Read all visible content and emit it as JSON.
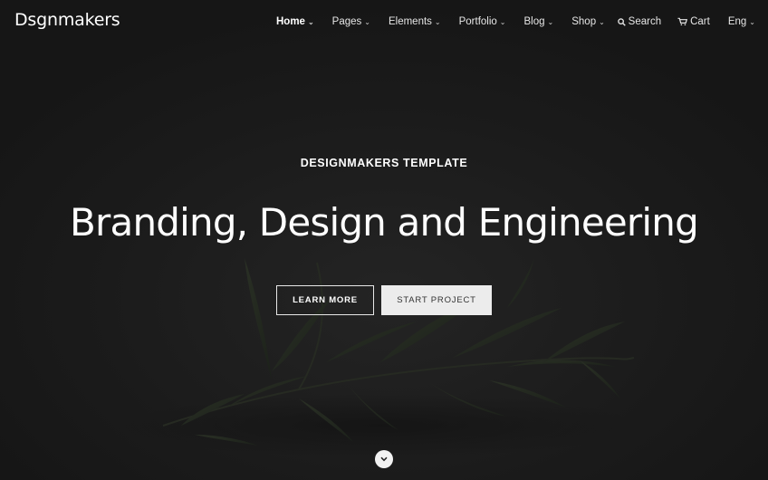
{
  "brand": {
    "logo": "Dsgnmakers"
  },
  "nav": {
    "items": [
      {
        "label": "Home",
        "active": true
      },
      {
        "label": "Pages",
        "active": false
      },
      {
        "label": "Elements",
        "active": false
      },
      {
        "label": "Portfolio",
        "active": false
      },
      {
        "label": "Blog",
        "active": false
      },
      {
        "label": "Shop",
        "active": false
      }
    ]
  },
  "tools": {
    "search_label": "Search",
    "cart_label": "Cart",
    "language": "Eng"
  },
  "hero": {
    "eyebrow": "DESIGNMAKERS TEMPLATE",
    "headline": "Branding, Design and Engineering",
    "primary_button": "LEARN MORE",
    "secondary_button": "START PROJECT"
  },
  "icons": {
    "nav_dropdown": "chevron-down-icon",
    "search": "search-icon",
    "cart": "cart-icon",
    "language_dropdown": "chevron-down-icon",
    "scroll": "chevron-down-icon"
  },
  "colors": {
    "background": "#1a1a1a",
    "text": "#ffffff",
    "secondary_button_bg": "#ececec",
    "secondary_button_text": "#333333"
  }
}
